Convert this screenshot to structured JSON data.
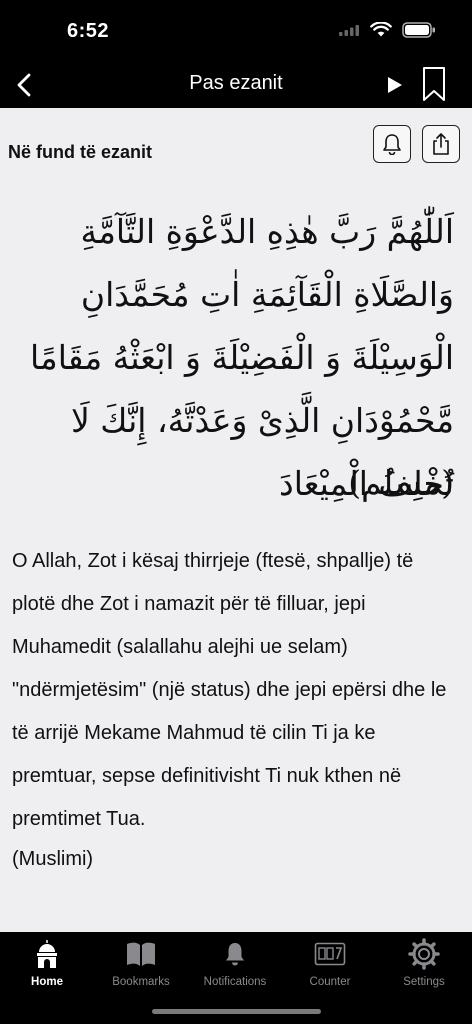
{
  "status_bar": {
    "time": "6:52"
  },
  "nav": {
    "title": "Pas ezanit"
  },
  "section": {
    "title": "Në fund të ezanit"
  },
  "dua": {
    "arabic": "اَللّٰهُمَّ رَبَّ هٰذِهِ الدَّعْوَةِ التَّآمَّةِ وَالصَّلَاةِ الْقَآئِمَةِ اٰتِ مُحَمَّدَانِ الْوَسِيْلَةَ وَ الْفَضِيْلَةَ وَ ابْعَثْهُ مَقَامًا مَّحْمُوْدَانِ الَّذِىْ وَعَدْتَّهُ، إِنَّكَ لَا تُخْلِفُ الْمِيْعَادَ",
    "arabic_source": "(مسلم)",
    "translation": "O Allah, Zot i kësaj thirrjeje (ftesë, shpallje) të plotë dhe Zot i namazit për të filluar, jepi Muhamedit (salallahu alejhi ue selam) \"ndërmjetësim\" (një status) dhe jepi epërsi dhe le të arrijë Mekame Mahmud të cilin Ti ja ke premtuar, sepse definitivisht Ti nuk kthen në premtimet Tua.",
    "translation_source": "(Muslimi)"
  },
  "tabs": [
    {
      "label": "Home",
      "icon": "mosque-icon",
      "active": true
    },
    {
      "label": "Bookmarks",
      "icon": "book-icon",
      "active": false
    },
    {
      "label": "Notifications",
      "icon": "bell-icon",
      "active": false
    },
    {
      "label": "Counter",
      "icon": "counter-icon",
      "active": false
    },
    {
      "label": "Settings",
      "icon": "gear-icon",
      "active": false
    }
  ],
  "colors": {
    "bar_background": "#000000",
    "content_background": "#efeff1",
    "inactive_tab": "#8a8a8e",
    "active_tab": "#ffffff"
  }
}
